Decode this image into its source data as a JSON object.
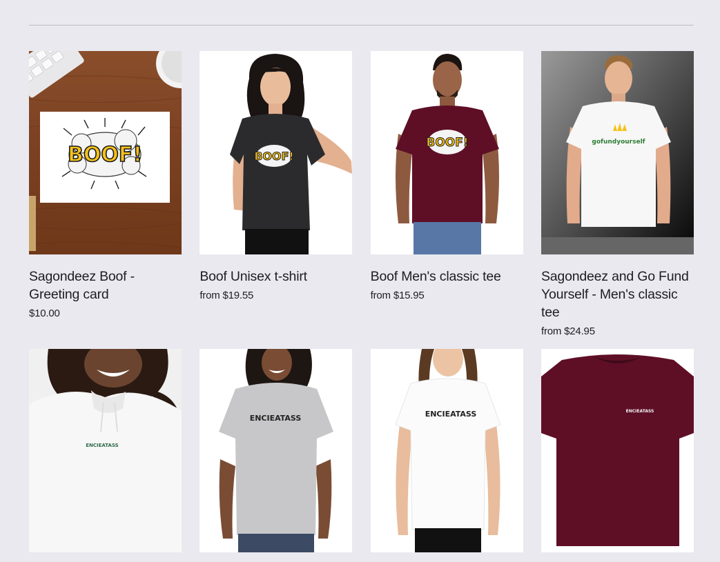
{
  "products": [
    {
      "title": "Sagondeez Boof - Greeting card",
      "price": "$10.00",
      "art_text": "BOOF!",
      "image": "greeting-card"
    },
    {
      "title": "Boof Unisex t-shirt",
      "price": "from $19.55",
      "art_text": "BOOF!",
      "image": "black-tshirt"
    },
    {
      "title": "Boof Men's classic tee",
      "price": "from $15.95",
      "art_text": "BOOF!",
      "image": "maroon-tshirt"
    },
    {
      "title": "Sagondeez and Go Fund Yourself - Men's classic tee",
      "price": "from $24.95",
      "art_text": "gofundyourself",
      "image": "white-tshirt"
    }
  ],
  "row2": [
    {
      "art_text": "ENCIEATASS",
      "image": "white-hoodie"
    },
    {
      "art_text": "ENCIEATASS",
      "image": "grey-tshirt"
    },
    {
      "art_text": "ENCIEATASS",
      "image": "white-tshirt-woman"
    },
    {
      "art_text": "ENCIEATASS",
      "image": "maroon-flat-tshirt"
    }
  ],
  "colors": {
    "background": "#e9e9ef",
    "maroon": "#5e0f26",
    "boof_yellow": "#f5c21b"
  }
}
